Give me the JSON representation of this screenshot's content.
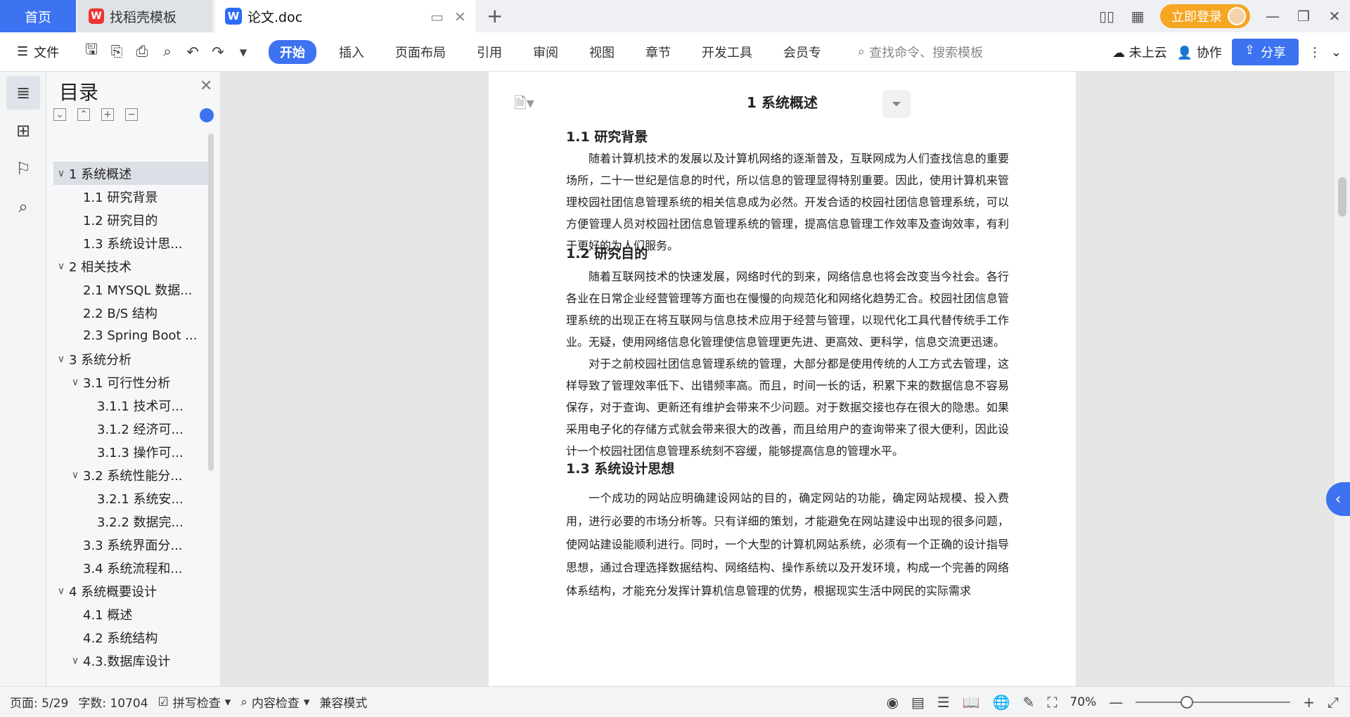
{
  "tabs": {
    "home": "首页",
    "template": "找稻壳模板",
    "doc": "论文.doc"
  },
  "top_right": {
    "login": "立即登录"
  },
  "ribbon": {
    "file": "文件",
    "tabs": [
      "开始",
      "插入",
      "页面布局",
      "引用",
      "审阅",
      "视图",
      "章节",
      "开发工具",
      "会员专"
    ],
    "search_placeholder": "查找命令、搜索模板",
    "cloud": "未上云",
    "collab": "协作",
    "share": "分享"
  },
  "toc": {
    "title": "目录",
    "items": [
      {
        "label": "1 系统概述",
        "level": 0,
        "expandable": true,
        "selected": true
      },
      {
        "label": "1.1  研究背景",
        "level": 1
      },
      {
        "label": "1.2 研究目的",
        "level": 1
      },
      {
        "label": "1.3 系统设计思...",
        "level": 1
      },
      {
        "label": "2 相关技术",
        "level": 0,
        "expandable": true
      },
      {
        "label": "2.1 MYSQL 数据...",
        "level": 1
      },
      {
        "label": "2.2 B/S 结构",
        "level": 1
      },
      {
        "label": "2.3 Spring Boot ...",
        "level": 1
      },
      {
        "label": "3 系统分析",
        "level": 0,
        "expandable": true
      },
      {
        "label": "3.1 可行性分析",
        "level": 1,
        "expandable": true
      },
      {
        "label": "3.1.1 技术可...",
        "level": 2
      },
      {
        "label": "3.1.2 经济可...",
        "level": 2
      },
      {
        "label": "3.1.3 操作可...",
        "level": 2
      },
      {
        "label": "3.2 系统性能分...",
        "level": 1,
        "expandable": true
      },
      {
        "label": "3.2.1  系统安...",
        "level": 2
      },
      {
        "label": "3.2.2  数据完...",
        "level": 2
      },
      {
        "label": "3.3 系统界面分...",
        "level": 1
      },
      {
        "label": "3.4 系统流程和...",
        "level": 1
      },
      {
        "label": "4 系统概要设计",
        "level": 0,
        "expandable": true
      },
      {
        "label": "4.1 概述",
        "level": 1
      },
      {
        "label": "4.2 系统结构",
        "level": 1
      },
      {
        "label": "4.3.数据库设计",
        "level": 1,
        "expandable": true
      }
    ]
  },
  "document": {
    "h1": "1 系统概述",
    "s11_title": "1.1  研究背景",
    "s11_p1": "随着计算机技术的发展以及计算机网络的逐渐普及，互联网成为人们查找信息的重要场所，二十一世纪是信息的时代，所以信息的管理显得特别重要。因此，使用计算机来管理校园社团信息管理系统的相关信息成为必然。开发合适的校园社团信息管理系统，可以方便管理人员对校园社团信息管理系统的管理，提高信息管理工作效率及查询效率，有利于更好的为人们服务。",
    "s12_title": "1.2 研究目的",
    "s12_p1": "随着互联网技术的快速发展，网络时代的到来，网络信息也将会改变当今社会。各行各业在日常企业经营管理等方面也在慢慢的向规范化和网络化趋势汇合。校园社团信息管理系统的出现正在将互联网与信息技术应用于经营与管理，以现代化工具代替传统手工作业。无疑，使用网络信息化管理使信息管理更先进、更高效、更科学，信息交流更迅速。",
    "s12_p2": "对于之前校园社团信息管理系统的管理，大部分都是使用传统的人工方式去管理，这样导致了管理效率低下、出错频率高。而且，时间一长的话，积累下来的数据信息不容易保存，对于查询、更新还有维护会带来不少问题。对于数据交接也存在很大的隐患。如果采用电子化的存储方式就会带来很大的改善，而且给用户的查询带来了很大便利，因此设计一个校园社团信息管理系统刻不容缓，能够提高信息的管理水平。",
    "s13_title": "1.3 系统设计思想",
    "s13_p1": "一个成功的网站应明确建设网站的目的，确定网站的功能，确定网站规模、投入费用，进行必要的市场分析等。只有详细的策划，才能避免在网站建设中出现的很多问题，使网站建设能顺利进行。同时，一个大型的计算机网站系统，必须有一个正确的设计指导思想，通过合理选择数据结构、网络结构、操作系统以及开发环境，构成一个完善的网络体系结构，才能充分发挥计算机信息管理的优势，根据现实生活中网民的实际需求"
  },
  "status": {
    "page": "页面: 5/29",
    "words": "字数: 10704",
    "spell": "拼写检查",
    "content": "内容检查",
    "compat": "兼容模式",
    "zoom": "70%"
  },
  "colors": {
    "accent": "#3d72f0",
    "login": "#f5a623"
  }
}
